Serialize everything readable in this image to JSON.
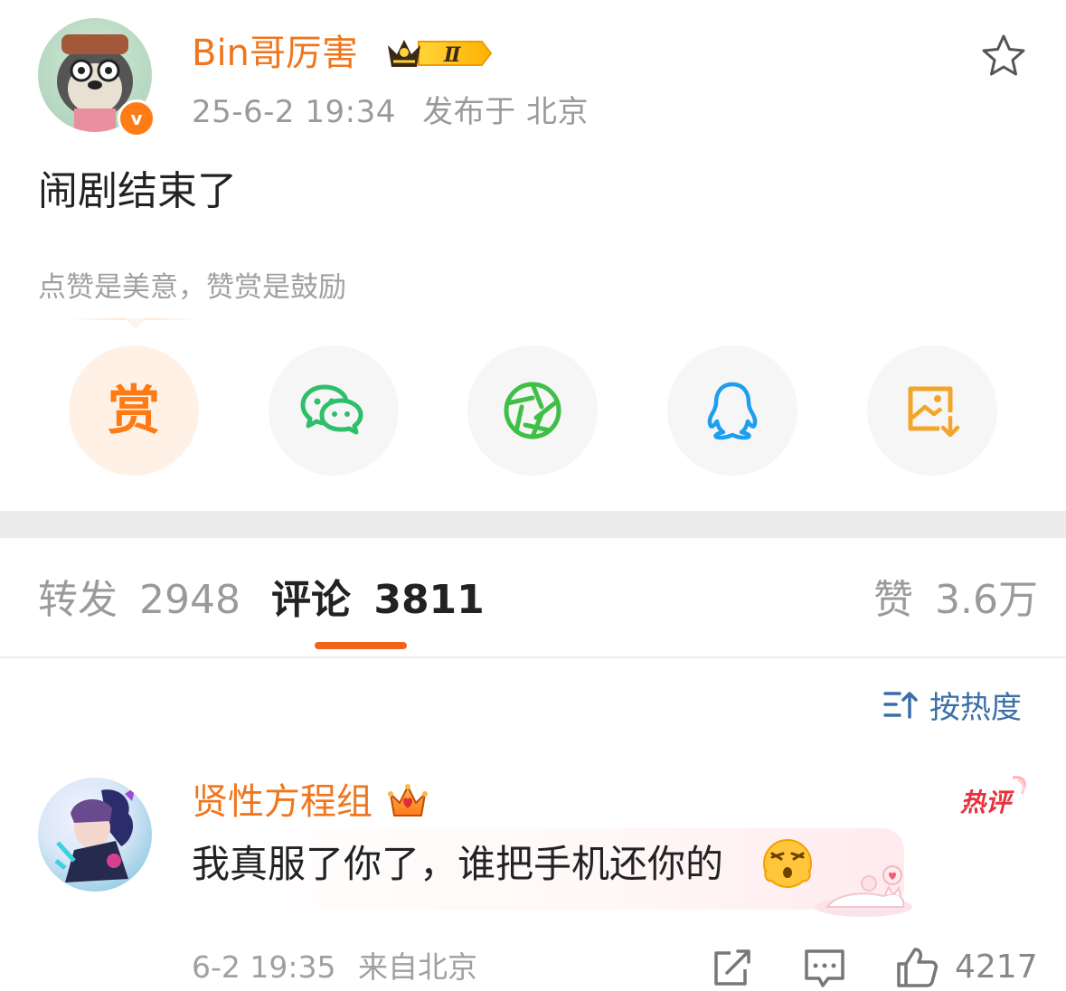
{
  "post": {
    "author": "Bin哥厉害",
    "badge_level": "Ⅱ",
    "timestamp": "25-6-2 19:34",
    "location": "发布于 北京",
    "content": "闹剧结束了",
    "reward_hint": "点赞是美意，赞赏是鼓励"
  },
  "share": {
    "reward_label": "赏",
    "icons": [
      "wechat-icon",
      "moments-icon",
      "qq-icon",
      "save-image-icon"
    ]
  },
  "tabs": {
    "repost_label": "转发",
    "repost_count": "2948",
    "comment_label": "评论",
    "comment_count": "3811",
    "like_label": "赞",
    "like_count": "3.6万"
  },
  "sort": {
    "label": "按热度"
  },
  "comment": {
    "author": "贤性方程组",
    "hot_label": "热评",
    "text": "我真服了你了，谁把手机还你的",
    "time": "6-2 19:35",
    "location": "来自北京",
    "likes": "4217"
  },
  "colors": {
    "accent": "#f0761d",
    "tab_underline": "#f4631c",
    "sort": "#3a6fa7",
    "wechat": "#2fbf6b",
    "moments": "#3fbf47",
    "qq": "#1e9ef0",
    "save": "#f2a52a"
  }
}
